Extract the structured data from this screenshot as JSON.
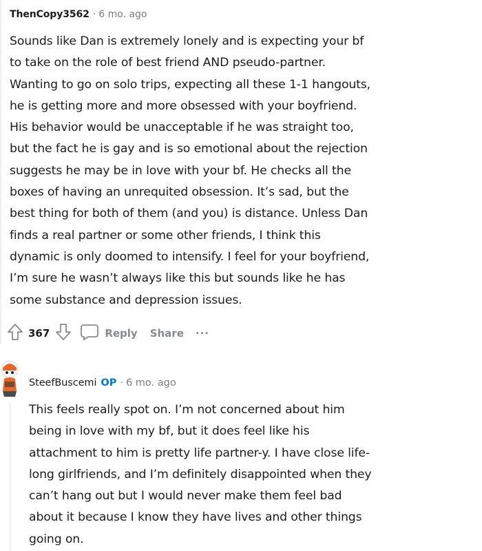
{
  "comment1": {
    "username": "ThenCopy3562",
    "separator": "·",
    "time": "6 mo. ago",
    "lines": [
      "Sounds like Dan is extremely lonely and is expecting your bf",
      "to take on the role of best friend AND pseudo-partner.",
      "Wanting to go on solo trips, expecting all these 1-1 hangouts,",
      "he is getting more and more obsessed with your boyfriend.",
      "His behavior would be unacceptable if he was straight too,",
      "but the fact he is gay and is so emotional about the rejection",
      "suggests he may be in love with your bf. He checks all the",
      "boxes of having an unrequited obsession. It’s sad, but the",
      "best thing for both of them (and you) is distance. Unless Dan",
      "finds a real partner or some other friends, I think this",
      "dynamic is only doomed to intensify. I feel for your boyfriend,",
      "I’m sure he wasn’t always like this but sounds like he has",
      "some substance and depression issues."
    ],
    "actions": {
      "vote_count": "367",
      "reply_label": "Reply",
      "share_label": "Share",
      "more_label": "···"
    }
  },
  "comment2": {
    "username": "SteefBuscemi",
    "op_badge": "OP",
    "separator": "·",
    "time": "6 mo. ago",
    "lines": [
      "This feels really spot on. I’m not concerned about him",
      "being in love with my bf, but it does feel like his",
      "attachment to him is pretty life partner-y. I have close life-",
      "long girlfriends, and I’m definitely disappointed when they",
      "can’t hang out but I would never make them feel bad",
      "about it because I know they have lives and other things",
      "going on."
    ]
  },
  "icons": {
    "upvote": "upvote-arrow-icon",
    "downvote": "downvote-arrow-icon",
    "reply": "speech-bubble-icon",
    "avatar": "snoo-avatar-icon"
  },
  "colors": {
    "text": "#1c1c1c",
    "meta": "#7c7c7c",
    "action": "#878a8c",
    "op_badge": "#0079d3",
    "avatar_accent": "#e5672a"
  }
}
